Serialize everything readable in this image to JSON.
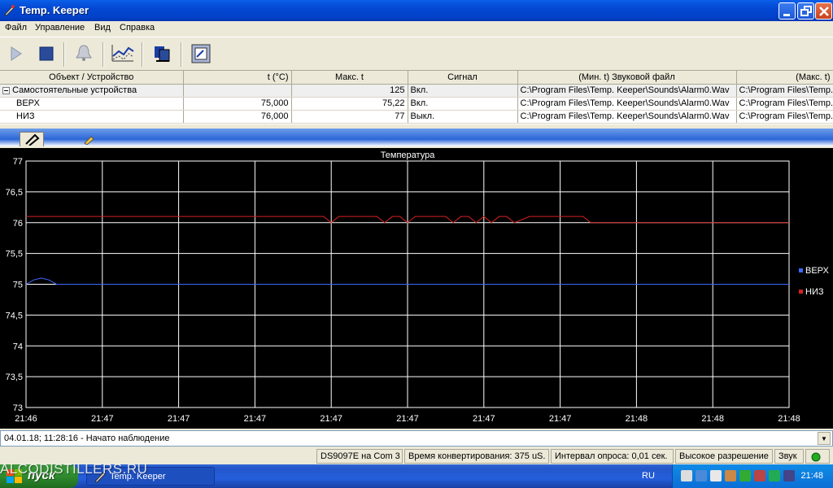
{
  "window": {
    "title": "Temp. Keeper"
  },
  "menu": [
    "Файл",
    "Управление",
    "Вид",
    "Справка"
  ],
  "toolbar": [
    "play-icon",
    "stop-icon",
    "bell-icon",
    "chart-icon",
    "devices-icon",
    "settings-icon"
  ],
  "table": {
    "columns": [
      "Объект / Устройство",
      "t (°C)",
      "Макс. t",
      "Сигнал",
      "(Мин. t) Звуковой файл",
      "(Макс. t)"
    ],
    "group": {
      "name": "Самостоятельные устройства",
      "max": "125",
      "signal": "Вкл.",
      "sound_min": "C:\\Program Files\\Temp. Keeper\\Sounds\\Alarm0.Wav",
      "sound_max": "C:\\Program Files\\Temp."
    },
    "rows": [
      {
        "name": "ВЕРХ",
        "t": "75,000",
        "max": "75,22",
        "signal": "Вкл.",
        "sound_min": "C:\\Program Files\\Temp. Keeper\\Sounds\\Alarm0.Wav",
        "sound_max": "C:\\Program Files\\Temp."
      },
      {
        "name": "НИЗ",
        "t": "76,000",
        "max": "77",
        "signal": "Выкл.",
        "sound_min": "C:\\Program Files\\Temp. Keeper\\Sounds\\Alarm0.Wav",
        "sound_max": "C:\\Program Files\\Temp."
      }
    ]
  },
  "chart_data": {
    "type": "line",
    "title": "Температура",
    "ylim": [
      73,
      77
    ],
    "y_ticks": [
      "77",
      "76,5",
      "76",
      "75,5",
      "75",
      "74,5",
      "74",
      "73,5",
      "73"
    ],
    "x_ticks": [
      "21:46",
      "21:47",
      "21:47",
      "21:47",
      "21:47",
      "21:47",
      "21:47",
      "21:47",
      "21:48",
      "21:48",
      "21:48"
    ],
    "grid": true,
    "legend": "right",
    "series": [
      {
        "name": "ВЕРХ",
        "color": "#3b6bff",
        "x": [
          0,
          0.1,
          0.2,
          0.3,
          0.4,
          10
        ],
        "y": [
          75,
          75.07,
          75.1,
          75.07,
          75,
          75
        ]
      },
      {
        "name": "НИЗ",
        "color": "#d42020",
        "x": [
          0,
          3.9,
          4.0,
          4.1,
          4.6,
          4.7,
          4.8,
          4.9,
          5.0,
          5.1,
          5.5,
          5.6,
          5.7,
          5.8,
          5.9,
          6.0,
          6.1,
          6.2,
          6.3,
          6.4,
          6.6,
          6.7,
          6.8,
          7.3,
          7.4,
          10
        ],
        "y": [
          76.1,
          76.1,
          76.0,
          76.1,
          76.1,
          76.0,
          76.1,
          76.1,
          76.0,
          76.1,
          76.1,
          76.0,
          76.1,
          76.1,
          76.0,
          76.1,
          76.0,
          76.1,
          76.1,
          76.0,
          76.1,
          76.1,
          76.1,
          76.1,
          76.0,
          76.0
        ]
      }
    ]
  },
  "log_line": "04.01.18; 11:28:16 - Начато наблюдение",
  "status": [
    "DS9097E на Com 3",
    "Время конвертирования: 375 uS.",
    "Интервал опроса: 0,01 сек.",
    "Высокое разрешение",
    "Звук"
  ],
  "status_color": "#22aa22",
  "taskbar": {
    "start": "пуск",
    "task": "Temp. Keeper",
    "lang": "RU",
    "clock": "21:48"
  },
  "watermark": "ALCODISTILLERS.RU"
}
